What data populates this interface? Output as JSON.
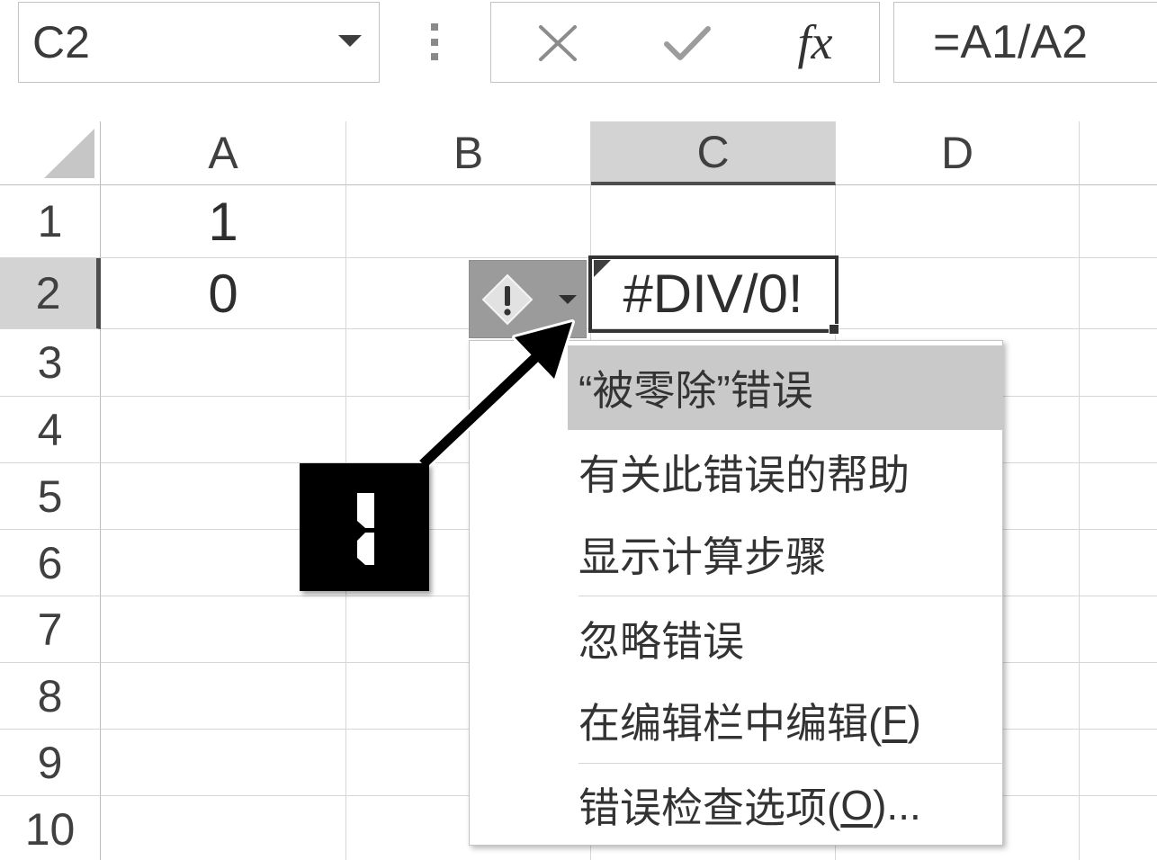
{
  "formula_bar": {
    "name_box_value": "C2",
    "name_box_dropdown_icon": "caret-down-icon",
    "resize_handle_icon": "vertical-dots-icon",
    "cancel_icon": "close-icon",
    "enter_icon": "check-icon",
    "function_label": "fx",
    "formula_value": "=A1/A2"
  },
  "sheet": {
    "select_all_icon": "select-all-triangle-icon",
    "column_headers": [
      "A",
      "B",
      "C",
      "D"
    ],
    "row_headers": [
      "1",
      "2",
      "3",
      "4",
      "5",
      "6",
      "7",
      "8",
      "9",
      "10"
    ],
    "cells": {
      "A1": "1",
      "A2": "0",
      "C2": "#DIV/0!"
    },
    "error_marker_icon": "error-triangle-icon",
    "fill_handle_icon": "fill-handle-icon"
  },
  "error_button": {
    "icon": "warning-diamond-icon",
    "dropdown_icon": "caret-down-icon"
  },
  "context_menu": {
    "title": "“被零除”错误",
    "items": [
      {
        "label": "有关此错误的帮助"
      },
      {
        "label": "显示计算步骤"
      },
      {
        "label": "忽略错误"
      },
      {
        "label": "在编辑栏中编辑(",
        "accelerator": "F",
        "suffix": ")"
      },
      {
        "label": "错误检查选项(",
        "accelerator": "O",
        "suffix": ")..."
      }
    ]
  },
  "callout": {
    "marker_icon": "callout-marker-icon",
    "arrow_icon": "arrow-icon"
  },
  "colors": {
    "selection_border": "#333333",
    "header_highlight": "#d3d3d3",
    "menu_highlight": "#c9c9c9",
    "error_button_fill": "#9b9b9b",
    "callout_fill": "#000000"
  }
}
